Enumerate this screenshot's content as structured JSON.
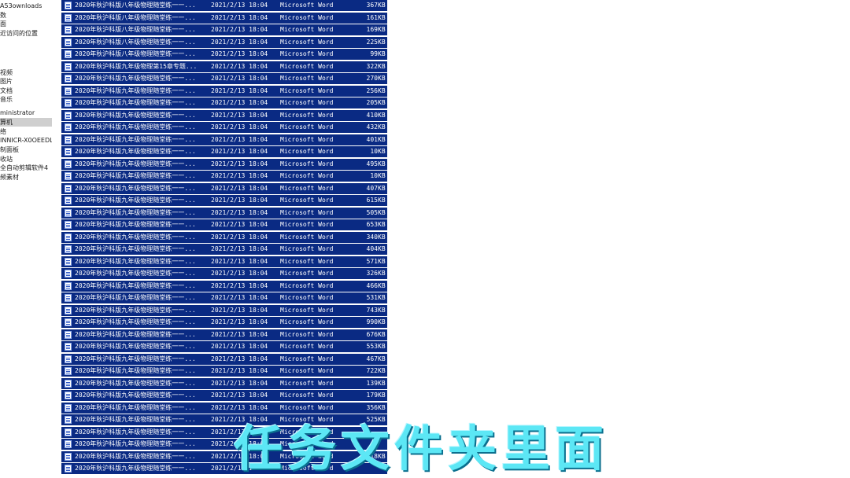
{
  "nav": {
    "items": [
      {
        "label": "A53ownloads",
        "selected": false
      },
      {
        "label": "数",
        "selected": false
      },
      {
        "label": "面",
        "selected": false
      },
      {
        "label": "近访问的位置",
        "selected": false
      },
      {
        "label": "",
        "selected": false
      },
      {
        "label": "",
        "selected": false
      },
      {
        "label": "",
        "selected": false
      },
      {
        "label": "视频",
        "selected": false
      },
      {
        "label": "图片",
        "selected": false
      },
      {
        "label": "文档",
        "selected": false
      },
      {
        "label": "音乐",
        "selected": false
      },
      {
        "label": "ministrator",
        "selected": false
      },
      {
        "label": "算机",
        "selected": true
      },
      {
        "label": "络",
        "selected": false
      },
      {
        "label": "INNICR-X0OEEDL",
        "selected": false
      },
      {
        "label": "制面板",
        "selected": false
      },
      {
        "label": "收站",
        "selected": false
      },
      {
        "label": "全自动剪辑软件4",
        "selected": false
      },
      {
        "label": "频素材",
        "selected": false
      }
    ]
  },
  "files": [
    {
      "name": "2020年秋沪科版八年级物理随堂练一一...",
      "date": "2021/2/13 18:04",
      "type": "Microsoft Word",
      "size": "367",
      "unit": "KB"
    },
    {
      "name": "2020年秋沪科版八年级物理随堂练一一...",
      "date": "2021/2/13 18:04",
      "type": "Microsoft Word",
      "size": "161",
      "unit": "KB"
    },
    {
      "name": "2020年秋沪科版八年级物理随堂练一一...",
      "date": "2021/2/13 18:04",
      "type": "Microsoft Word",
      "size": "169",
      "unit": "KB"
    },
    {
      "name": "2020年秋沪科版八年级物理随堂练一一...",
      "date": "2021/2/13 18:04",
      "type": "Microsoft Word",
      "size": "225",
      "unit": "KB"
    },
    {
      "name": "2020年秋沪科版八年级物理随堂练一一...",
      "date": "2021/2/13 18:04",
      "type": "Microsoft Word",
      "size": "99",
      "unit": "KB"
    },
    {
      "name": "2020年秋沪科版九年级物理第15章专题...",
      "date": "2021/2/13 18:04",
      "type": "Microsoft Word",
      "size": "322",
      "unit": "KB"
    },
    {
      "name": "2020年秋沪科版九年级物理随堂练一一...",
      "date": "2021/2/13 18:04",
      "type": "Microsoft Word",
      "size": "270",
      "unit": "KB"
    },
    {
      "name": "2020年秋沪科版九年级物理随堂练一一...",
      "date": "2021/2/13 18:04",
      "type": "Microsoft Word",
      "size": "256",
      "unit": "KB"
    },
    {
      "name": "2020年秋沪科版九年级物理随堂练一一...",
      "date": "2021/2/13 18:04",
      "type": "Microsoft Word",
      "size": "205",
      "unit": "KB"
    },
    {
      "name": "2020年秋沪科版九年级物理随堂练一一...",
      "date": "2021/2/13 18:04",
      "type": "Microsoft Word",
      "size": "410",
      "unit": "KB"
    },
    {
      "name": "2020年秋沪科版九年级物理随堂练一一...",
      "date": "2021/2/13 18:04",
      "type": "Microsoft Word",
      "size": "432",
      "unit": "KB"
    },
    {
      "name": "2020年秋沪科版九年级物理随堂练一一...",
      "date": "2021/2/13 18:04",
      "type": "Microsoft Word",
      "size": "401",
      "unit": "KB"
    },
    {
      "name": "2020年秋沪科版九年级物理随堂练一一...",
      "date": "2021/2/13 18:04",
      "type": "Microsoft Word",
      "size": "10",
      "unit": "KB"
    },
    {
      "name": "2020年秋沪科版九年级物理随堂练一一...",
      "date": "2021/2/13 18:04",
      "type": "Microsoft Word",
      "size": "495",
      "unit": "KB"
    },
    {
      "name": "2020年秋沪科版九年级物理随堂练一一...",
      "date": "2021/2/13 18:04",
      "type": "Microsoft Word",
      "size": "10",
      "unit": "KB"
    },
    {
      "name": "2020年秋沪科版九年级物理随堂练一一...",
      "date": "2021/2/13 18:04",
      "type": "Microsoft Word",
      "size": "407",
      "unit": "KB"
    },
    {
      "name": "2020年秋沪科版九年级物理随堂练一一...",
      "date": "2021/2/13 18:04",
      "type": "Microsoft Word",
      "size": "615",
      "unit": "KB"
    },
    {
      "name": "2020年秋沪科版九年级物理随堂练一一...",
      "date": "2021/2/13 18:04",
      "type": "Microsoft Word",
      "size": "505",
      "unit": "KB"
    },
    {
      "name": "2020年秋沪科版九年级物理随堂练一一...",
      "date": "2021/2/13 18:04",
      "type": "Microsoft Word",
      "size": "653",
      "unit": "KB"
    },
    {
      "name": "2020年秋沪科版九年级物理随堂练一一...",
      "date": "2021/2/13 18:04",
      "type": "Microsoft Word",
      "size": "340",
      "unit": "KB"
    },
    {
      "name": "2020年秋沪科版九年级物理随堂练一一...",
      "date": "2021/2/13 18:04",
      "type": "Microsoft Word",
      "size": "404",
      "unit": "KB"
    },
    {
      "name": "2020年秋沪科版九年级物理随堂练一一...",
      "date": "2021/2/13 18:04",
      "type": "Microsoft Word",
      "size": "571",
      "unit": "KB"
    },
    {
      "name": "2020年秋沪科版九年级物理随堂练一一...",
      "date": "2021/2/13 18:04",
      "type": "Microsoft Word",
      "size": "326",
      "unit": "KB"
    },
    {
      "name": "2020年秋沪科版九年级物理随堂练一一...",
      "date": "2021/2/13 18:04",
      "type": "Microsoft Word",
      "size": "466",
      "unit": "KB"
    },
    {
      "name": "2020年秋沪科版九年级物理随堂练一一...",
      "date": "2021/2/13 18:04",
      "type": "Microsoft Word",
      "size": "531",
      "unit": "KB"
    },
    {
      "name": "2020年秋沪科版九年级物理随堂练一一...",
      "date": "2021/2/13 18:04",
      "type": "Microsoft Word",
      "size": "743",
      "unit": "KB"
    },
    {
      "name": "2020年秋沪科版九年级物理随堂练一一...",
      "date": "2021/2/13 18:04",
      "type": "Microsoft Word",
      "size": "990",
      "unit": "KB"
    },
    {
      "name": "2020年秋沪科版九年级物理随堂练一一...",
      "date": "2021/2/13 18:04",
      "type": "Microsoft Word",
      "size": "676",
      "unit": "KB"
    },
    {
      "name": "2020年秋沪科版九年级物理随堂练一一...",
      "date": "2021/2/13 18:04",
      "type": "Microsoft Word",
      "size": "553",
      "unit": "KB"
    },
    {
      "name": "2020年秋沪科版九年级物理随堂练一一...",
      "date": "2021/2/13 18:04",
      "type": "Microsoft Word",
      "size": "467",
      "unit": "KB"
    },
    {
      "name": "2020年秋沪科版九年级物理随堂练一一...",
      "date": "2021/2/13 18:04",
      "type": "Microsoft Word",
      "size": "722",
      "unit": "KB"
    },
    {
      "name": "2020年秋沪科版九年级物理随堂练一一...",
      "date": "2021/2/13 18:04",
      "type": "Microsoft Word",
      "size": "139",
      "unit": "KB"
    },
    {
      "name": "2020年秋沪科版九年级物理随堂练一一...",
      "date": "2021/2/13 18:04",
      "type": "Microsoft Word",
      "size": "179",
      "unit": "KB"
    },
    {
      "name": "2020年秋沪科版九年级物理随堂练一一...",
      "date": "2021/2/13 18:04",
      "type": "Microsoft Word",
      "size": "356",
      "unit": "KB"
    },
    {
      "name": "2020年秋沪科版九年级物理随堂练一一...",
      "date": "2021/2/13 18:04",
      "type": "Microsoft Word",
      "size": "525",
      "unit": "KB"
    },
    {
      "name": "2020年秋沪科版九年级物理随堂练一一...",
      "date": "2021/2/13 18:04",
      "type": "Microsoft Word",
      "size": "",
      "unit": ""
    },
    {
      "name": "2020年秋沪科版九年级物理随堂练一一...",
      "date": "2021/2/13 18:04",
      "type": "Microsoft Word",
      "size": "",
      "unit": ""
    },
    {
      "name": "2020年秋沪科版九年级物理随堂练一一...",
      "date": "2021/2/13 18:04",
      "type": "Microsoft Word",
      "size": "318",
      "unit": "KB"
    },
    {
      "name": "2020年秋沪科版九年级物理随堂练一一...",
      "date": "2021/2/13 18:04",
      "type": "Microsoft Word",
      "size": "",
      "unit": ""
    }
  ],
  "caption": {
    "text": "任务文件夹里面"
  },
  "colors": {
    "selection": "#0a2a83",
    "caption": "#5ce7f5"
  }
}
